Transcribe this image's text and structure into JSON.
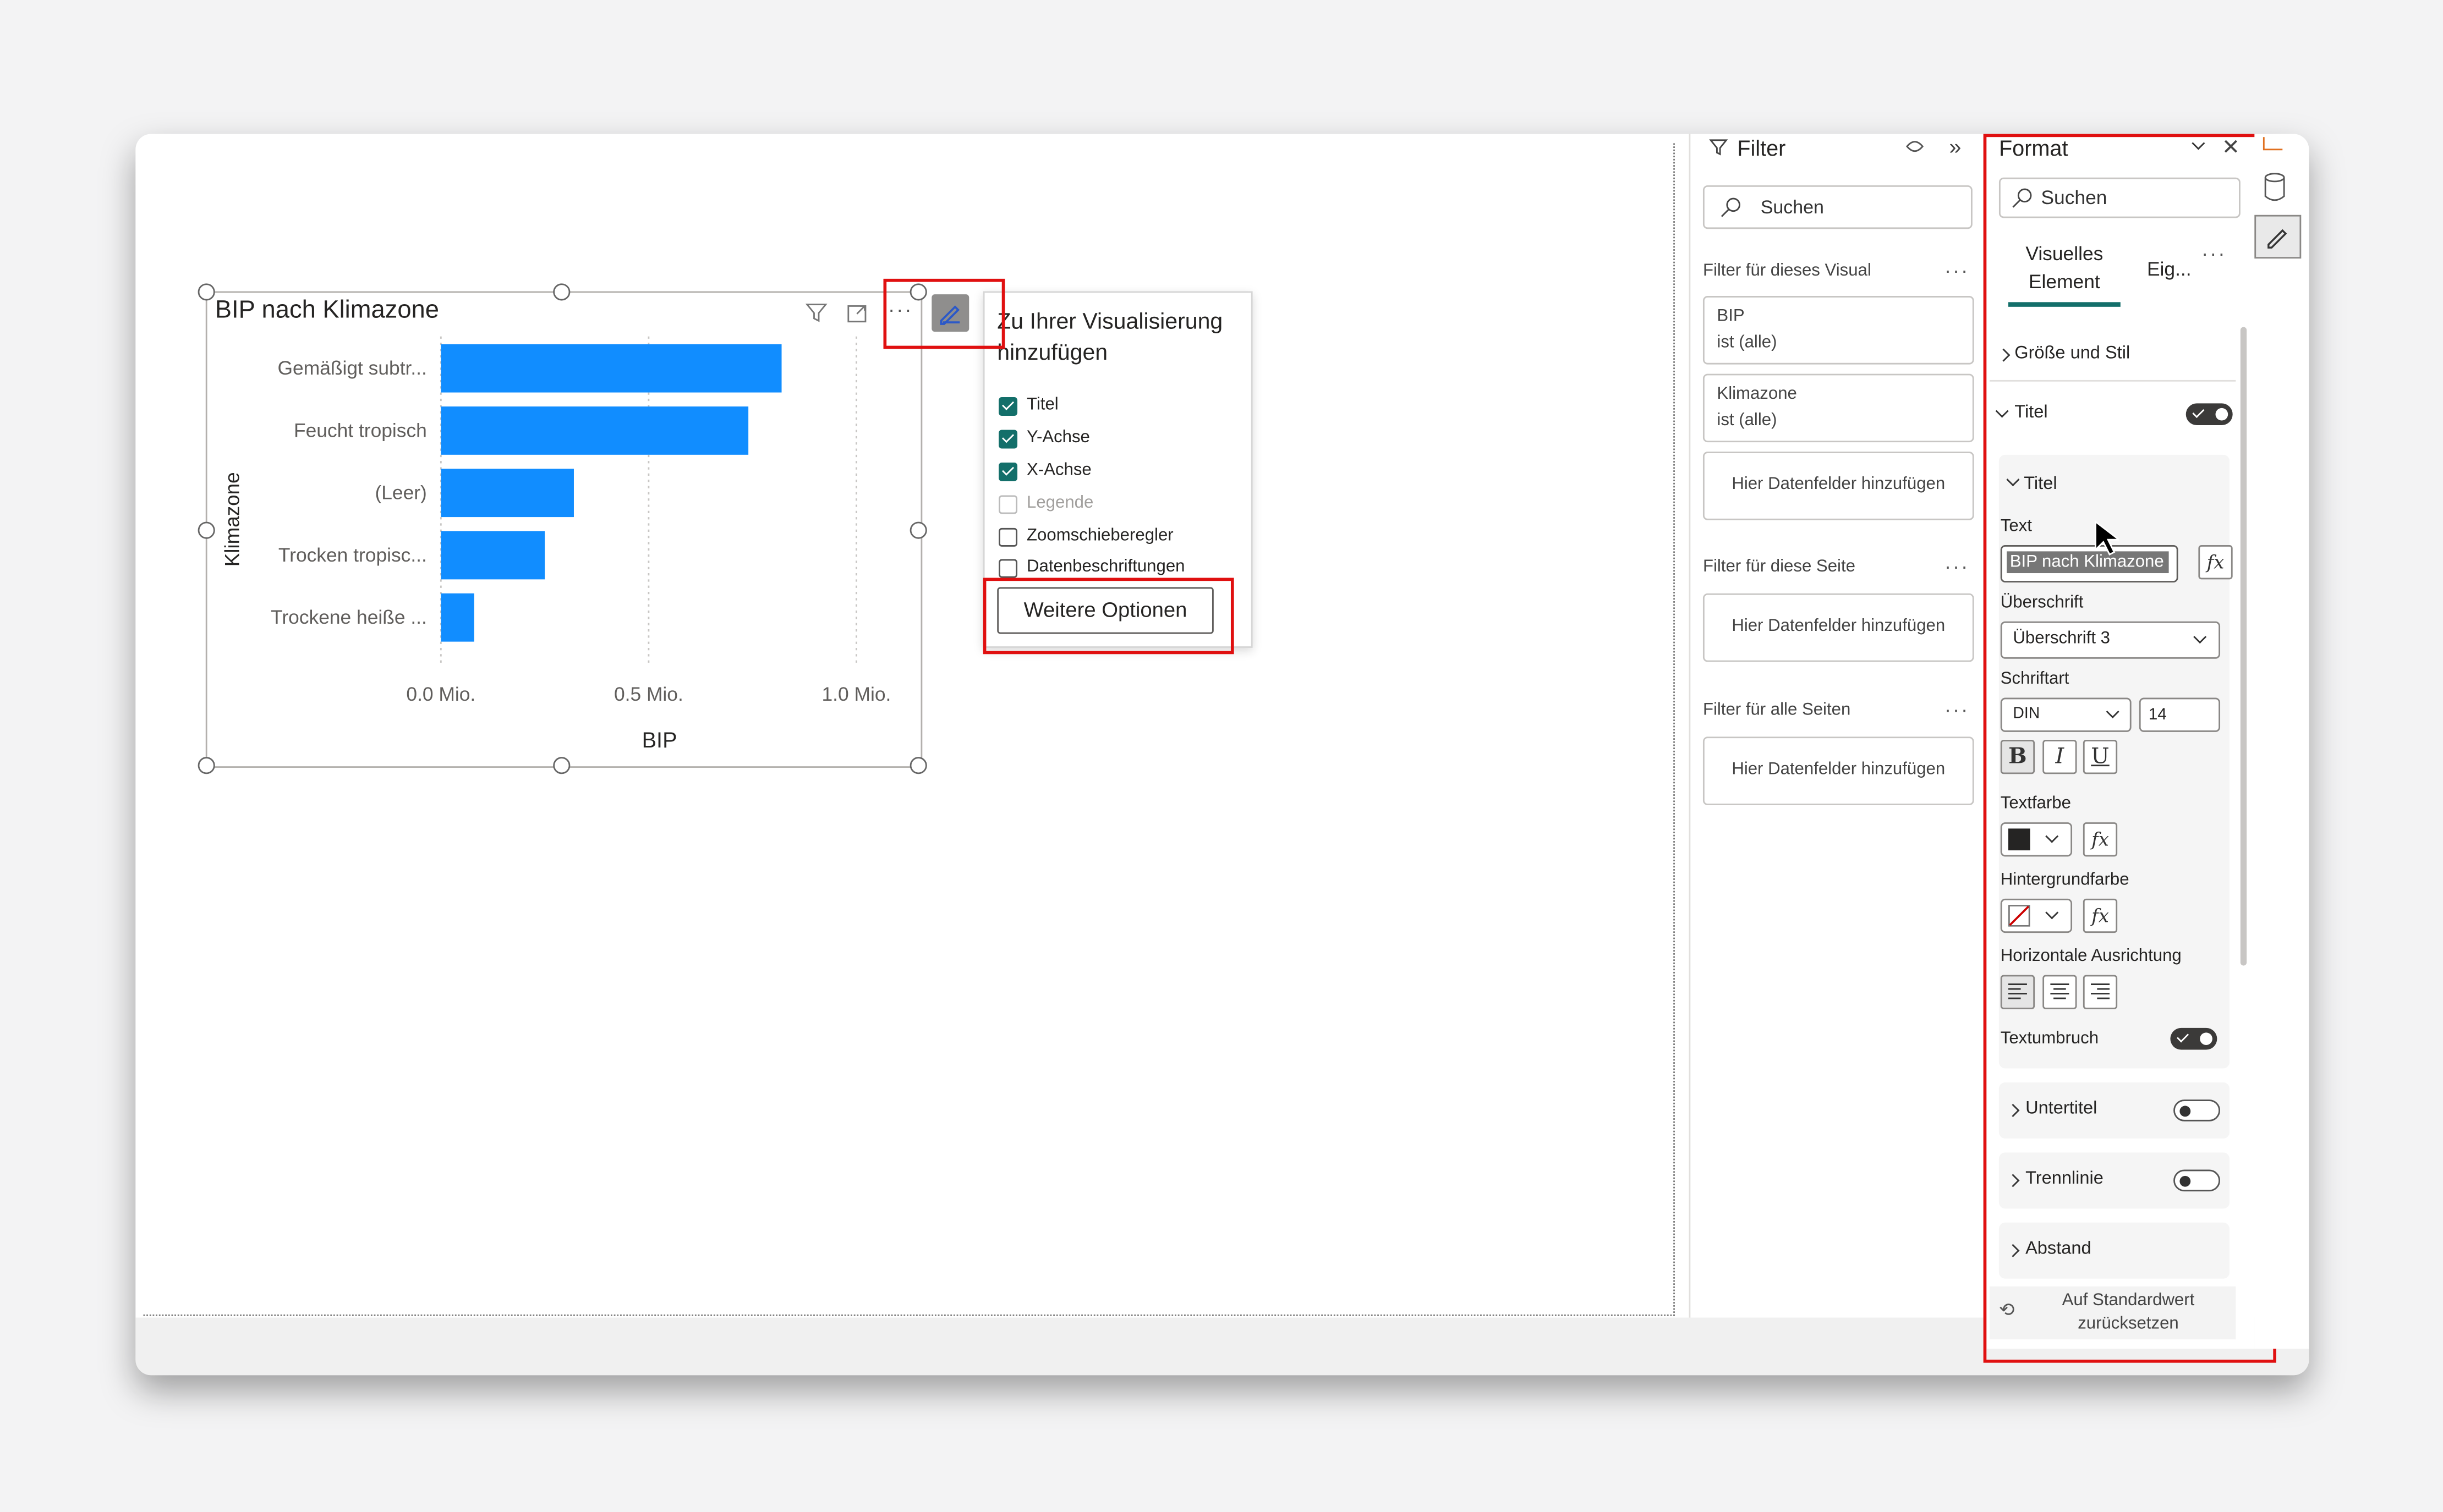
{
  "visual": {
    "title": "BIP nach Klimazone",
    "ylabel": "Klimazone",
    "xlabel": "BIP",
    "more": "···"
  },
  "chart_data": {
    "type": "bar",
    "orientation": "horizontal",
    "categories": [
      "Gemäßigt subtr...",
      "Feucht tropisch",
      "(Leer)",
      "Trocken tropisc...",
      "Trockene heiße ..."
    ],
    "values": [
      0.82,
      0.74,
      0.32,
      0.25,
      0.08
    ],
    "xticks": [
      "0.0 Mio.",
      "0.5 Mio.",
      "1.0 Mio."
    ],
    "xlim": [
      0,
      1.05
    ],
    "xlabel": "BIP",
    "ylabel": "Klimazone",
    "title": "BIP nach Klimazone",
    "bar_color": "#118dff",
    "grid": true
  },
  "popup": {
    "heading1": "Zu Ihrer Visualisierung",
    "heading2": "hinzufügen",
    "items": [
      {
        "label": "Titel",
        "checked": true
      },
      {
        "label": "Y-Achse",
        "checked": true
      },
      {
        "label": "X-Achse",
        "checked": true
      },
      {
        "label": "Legende",
        "checked": false,
        "disabled": true
      },
      {
        "label": "Zoomschieberegler",
        "checked": false
      },
      {
        "label": "Datenbeschriftungen",
        "checked": false
      }
    ],
    "button": "Weitere Optionen"
  },
  "filter": {
    "title": "Filter",
    "search": "Suchen",
    "sec1": "Filter für dieses Visual",
    "f1name": "BIP",
    "f1val": "ist (alle)",
    "f2name": "Klimazone",
    "f2val": "ist (alle)",
    "add": "Hier Datenfelder hinzufügen",
    "sec2": "Filter für diese Seite",
    "sec3": "Filter für alle Seiten",
    "more": "···"
  },
  "format": {
    "title": "Format",
    "search": "Suchen",
    "tab1a": "Visuelles",
    "tab1b": "Element",
    "tab2": "Eig...",
    "more": "···",
    "groesse": "Größe und Stil",
    "titel_section": "Titel",
    "titel_card": "Titel",
    "text_label": "Text",
    "text_value": "BIP  nach Klimazone",
    "fx": "fx",
    "ueberschrift_label": "Überschrift",
    "ueberschrift_value": "Überschrift 3",
    "schriftart_label": "Schriftart",
    "font_value": "DIN",
    "size_value": "14",
    "bold": "B",
    "italic": "I",
    "underline": "U",
    "textfarbe": "Textfarbe",
    "textfarbe_color": "#252423",
    "hintergrund": "Hintergrundfarbe",
    "ausrichtung": "Horizontale Ausrichtung",
    "umbruch": "Textumbruch",
    "untertitel": "Untertitel",
    "trennlinie": "Trennlinie",
    "abstand": "Abstand",
    "reset1": "Auf Standardwert",
    "reset2": "zurücksetzen"
  },
  "colors": {
    "accent": "#118dff",
    "highlight": "#e01010",
    "check": "#136f6a"
  }
}
